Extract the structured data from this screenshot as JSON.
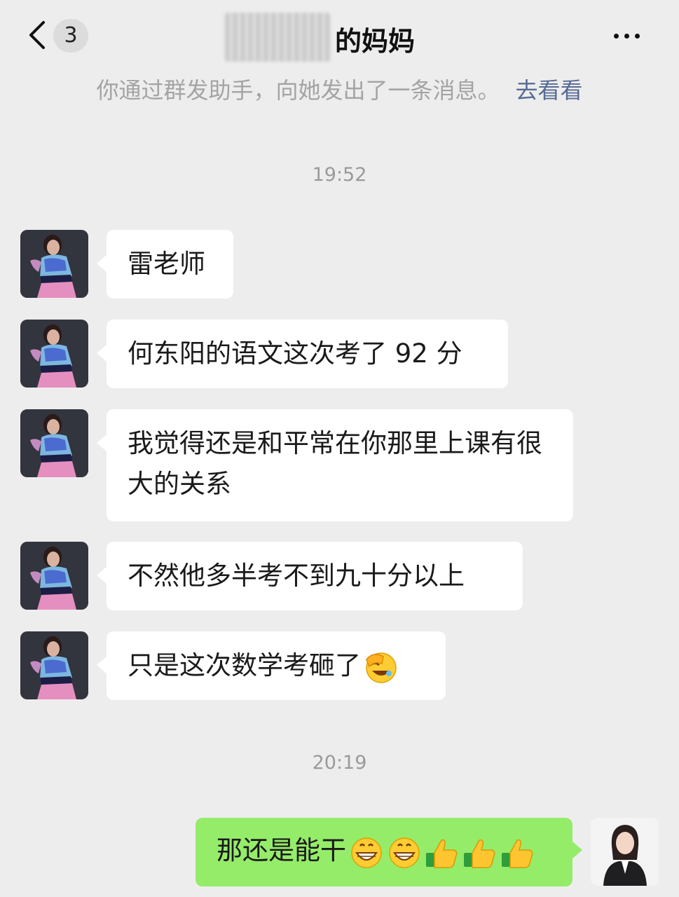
{
  "header": {
    "back_icon": "chevron-left-icon",
    "unread_count": "3",
    "title_suffix": "的妈妈",
    "more_icon": "more-dots-icon"
  },
  "notice": {
    "text": "你通过群发助手，向她发出了一条消息。",
    "link": "去看看"
  },
  "timestamps": [
    "19:52",
    "20:19"
  ],
  "messages_left": [
    {
      "text": "雷老师"
    },
    {
      "text": "何东阳的语文这次考了 92 分"
    },
    {
      "text": "我觉得还是和平常在你那里上课有很大的关系"
    },
    {
      "text": "不然他多半考不到九十分以上"
    },
    {
      "text": "只是这次数学考砸了",
      "emoji": "face-palm-laugh-icon"
    }
  ],
  "message_right": {
    "text": "那还是能干",
    "emojis": [
      "grin-icon",
      "grin-icon",
      "thumbs-up-icon",
      "thumbs-up-icon",
      "thumbs-up-icon"
    ]
  },
  "colors": {
    "background": "#ededed",
    "bubble_left": "#ffffff",
    "bubble_right": "#95ec69",
    "link": "#576b95"
  }
}
